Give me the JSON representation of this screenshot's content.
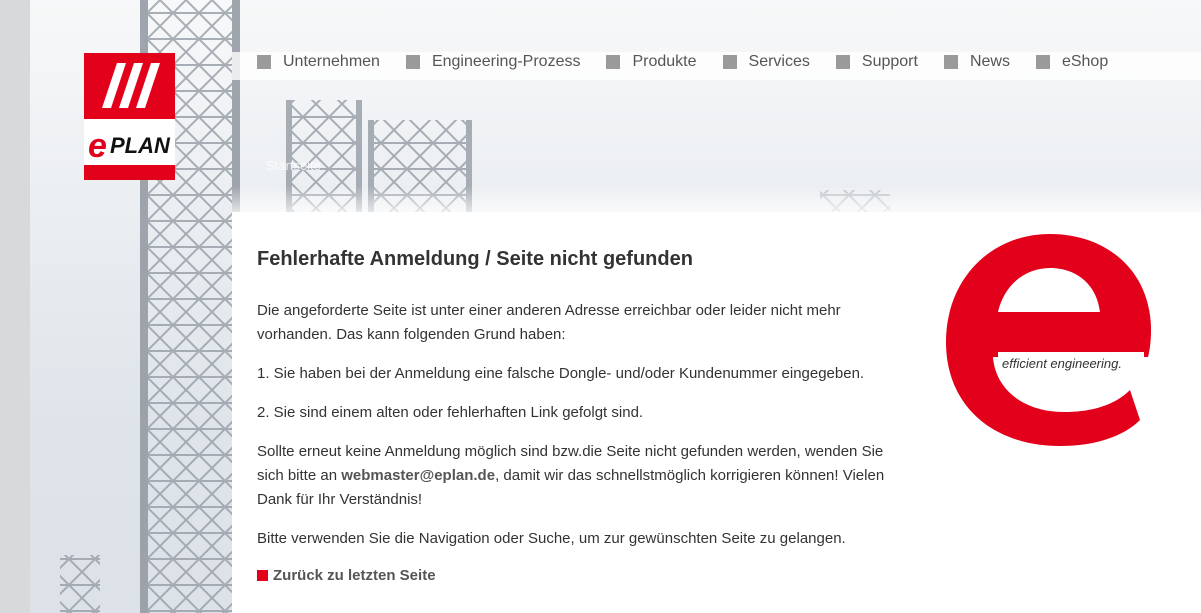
{
  "brand": {
    "logo_text": "ePLAN",
    "tagline": "efficient engineering.",
    "accent_color": "#e2001a"
  },
  "nav": {
    "items": [
      {
        "label": "Unternehmen"
      },
      {
        "label": "Engineering-Prozess"
      },
      {
        "label": "Produkte"
      },
      {
        "label": "Services"
      },
      {
        "label": "Support"
      },
      {
        "label": "News"
      },
      {
        "label": "eShop"
      }
    ]
  },
  "breadcrumb": "Startseite",
  "page": {
    "title": "Fehlerhafte Anmeldung / Seite nicht gefunden",
    "intro": "Die angeforderte Seite ist unter einer anderen Adresse erreichbar oder leider nicht mehr vorhanden. Das kann folgenden Grund haben:",
    "reason1": "1. Sie haben bei der Anmeldung eine falsche Dongle- und/oder Kundenummer eingegeben.",
    "reason2": "2. Sie sind einem alten oder fehlerhaften Link gefolgt sind.",
    "contact_before": "Sollte erneut keine Anmeldung möglich sind bzw.die Seite nicht gefunden werden, wenden Sie sich bitte an ",
    "contact_email": "webmaster@eplan.de",
    "contact_after": ", damit wir das schnellstmöglich korrigieren können! Vielen Dank für Ihr Verständnis!",
    "navigation_hint": "Bitte verwenden Sie die Navigation oder Suche, um zur gewünschten Seite zu gelangen.",
    "back_link": "Zurück zu letzten Seite"
  }
}
